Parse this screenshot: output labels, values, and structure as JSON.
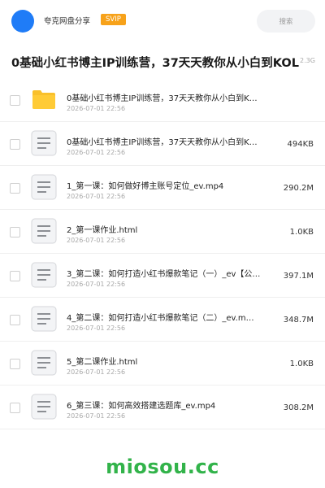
{
  "header": {
    "brand": "夸克网盘分享",
    "badge": "SVIP",
    "search_placeholder": "搜索"
  },
  "folder": {
    "title": "0基础小红书博主IP训练营，37天天教你从小白到KOL",
    "size": "2.3G"
  },
  "files": [
    {
      "icon": "folder",
      "name": "0基础小红书博主IP训练营，37天天教你从小白到K…",
      "date": "2026-07-01 22:56",
      "size": ""
    },
    {
      "icon": "doc",
      "name": "0基础小红书博主IP训练营，37天天教你从小白到K…",
      "date": "2026-07-01 22:56",
      "size": "494KB"
    },
    {
      "icon": "doc",
      "name": "1_第一课：如何做好博主账号定位_ev.mp4",
      "date": "2026-07-01 22:56",
      "size": "290.2M"
    },
    {
      "icon": "doc",
      "name": "2_第一课作业.html",
      "date": "2026-07-01 22:56",
      "size": "1.0KB"
    },
    {
      "icon": "doc",
      "name": "3_第二课：如何打造小红书爆款笔记（一）_ev【公…",
      "date": "2026-07-01 22:56",
      "size": "397.1M"
    },
    {
      "icon": "doc",
      "name": "4_第二课：如何打造小红书爆款笔记（二）_ev.m…",
      "date": "2026-07-01 22:56",
      "size": "348.7M"
    },
    {
      "icon": "doc",
      "name": "5_第二课作业.html",
      "date": "2026-07-01 22:56",
      "size": "1.0KB"
    },
    {
      "icon": "doc",
      "name": "6_第三课：如何高效搭建选题库_ev.mp4",
      "date": "2026-07-01 22:56",
      "size": "308.2M"
    }
  ],
  "watermark": "miosou.cc",
  "colors": {
    "avatar": "#1f7cf7",
    "svip": "#f7a21a",
    "folder_icon": "#f9c02b",
    "watermark": "#32b34a"
  }
}
